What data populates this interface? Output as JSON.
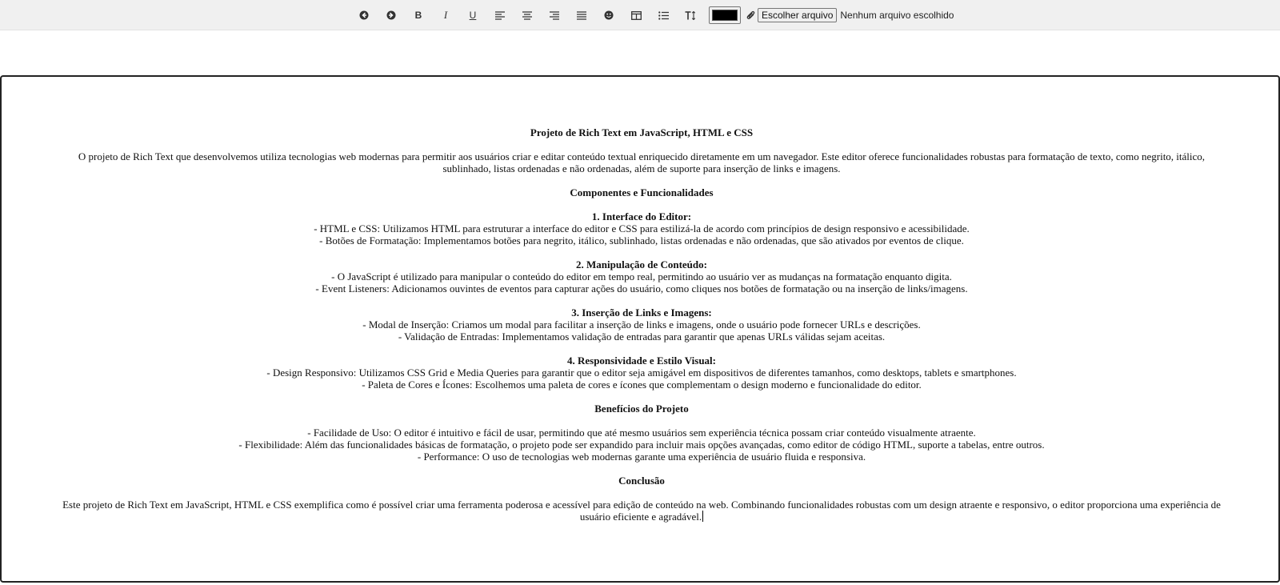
{
  "toolbar": {
    "buttons": [
      {
        "name": "undo-button",
        "icon": "arrow-left-circle-icon"
      },
      {
        "name": "redo-button",
        "icon": "arrow-right-circle-icon"
      },
      {
        "name": "bold-button",
        "label": "B"
      },
      {
        "name": "italic-button",
        "label": "I"
      },
      {
        "name": "underline-button",
        "label": "U"
      },
      {
        "name": "align-left-button",
        "icon": "align-left-icon"
      },
      {
        "name": "align-center-button",
        "icon": "align-center-icon"
      },
      {
        "name": "align-right-button",
        "icon": "align-right-icon"
      },
      {
        "name": "justify-button",
        "icon": "align-justify-icon"
      },
      {
        "name": "emoji-button",
        "icon": "smile-icon"
      },
      {
        "name": "table-button",
        "icon": "table-icon"
      },
      {
        "name": "list-button",
        "icon": "list-icon"
      },
      {
        "name": "font-size-button",
        "icon": "text-height-icon"
      }
    ],
    "color_value": "#000000",
    "file_button_label": "Escolher arquivo",
    "file_status": "Nenhum arquivo escolhido"
  },
  "document": {
    "title": "Projeto de Rich Text em JavaScript, HTML e CSS",
    "intro": "O projeto de Rich Text que desenvolvemos utiliza tecnologias web modernas para permitir aos usuários criar e editar conteúdo textual enriquecido diretamente em um navegador. Este editor oferece funcionalidades robustas para formatação de texto, como negrito, itálico, sublinhado, listas ordenadas e não ordenadas, além de suporte para inserção de links e imagens.",
    "section_components": "Componentes e Funcionalidades",
    "s1_title": "1. Interface do Editor:",
    "s1_l1": "- HTML e CSS: Utilizamos HTML para estruturar a interface do editor e CSS para estilizá-la de acordo com princípios de design responsivo e acessibilidade.",
    "s1_l2": "- Botões de Formatação: Implementamos botões para negrito, itálico, sublinhado, listas ordenadas e não ordenadas, que são ativados por eventos de clique.",
    "s2_title": "2. Manipulação de Conteúdo:",
    "s2_l1": "- O JavaScript é utilizado para manipular o conteúdo do editor em tempo real, permitindo ao usuário ver as mudanças na formatação enquanto digita.",
    "s2_l2": "- Event Listeners: Adicionamos ouvintes de eventos para capturar ações do usuário, como cliques nos botões de formatação ou na inserção de links/imagens.",
    "s3_title": "3. Inserção de Links e Imagens:",
    "s3_l1": "- Modal de Inserção: Criamos um modal para facilitar a inserção de links e imagens, onde o usuário pode fornecer URLs e descrições.",
    "s3_l2": "- Validação de Entradas: Implementamos validação de entradas para garantir que apenas URLs válidas sejam aceitas.",
    "s4_title": "4. Responsividade e Estilo Visual:",
    "s4_l1": "- Design Responsivo: Utilizamos CSS Grid e Media Queries para garantir que o editor seja amigável em dispositivos de diferentes tamanhos, como desktops, tablets e smartphones.",
    "s4_l2": "- Paleta de Cores e Ícones: Escolhemos uma paleta de cores e ícones que complementam o design moderno e funcionalidade do editor.",
    "section_benefits": "Benefícios do Projeto",
    "b_l1": "- Facilidade de Uso: O editor é intuitivo e fácil de usar, permitindo que até mesmo usuários sem experiência técnica possam criar conteúdo visualmente atraente.",
    "b_l2": "- Flexibilidade: Além das funcionalidades básicas de formatação, o projeto pode ser expandido para incluir mais opções avançadas, como editor de código HTML, suporte a tabelas, entre outros.",
    "b_l3": "- Performance: O uso de tecnologias web modernas garante uma experiência de usuário fluida e responsiva.",
    "section_conclusion": "Conclusão",
    "conclusion": "Este projeto de Rich Text em JavaScript, HTML e CSS exemplifica como é possível criar uma ferramenta poderosa e acessível para edição de conteúdo na web. Combinando funcionalidades robustas com um design atraente e responsivo, o editor proporciona uma experiência de usuário eficiente e agradável."
  }
}
